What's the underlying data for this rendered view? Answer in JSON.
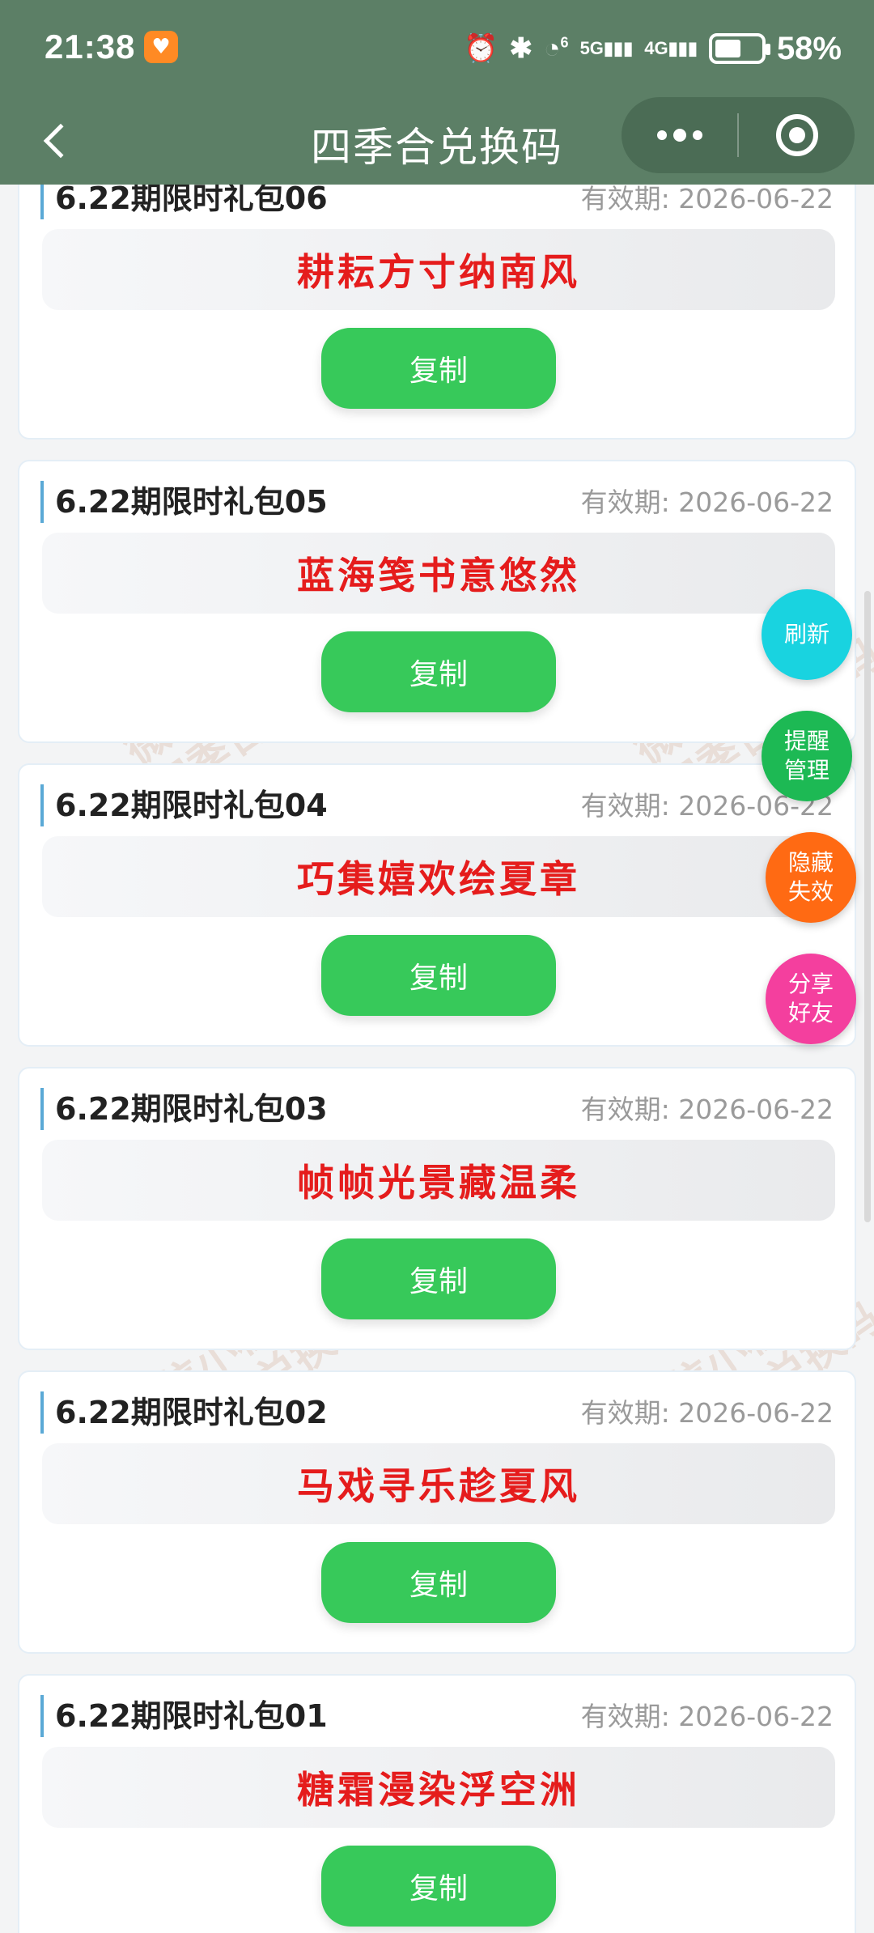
{
  "status_bar": {
    "time": "21:38",
    "app_badge_icon": "heart-icon",
    "icons": [
      "alarm-icon",
      "bluetooth-icon",
      "wifi-icon",
      "signal-5g-icon",
      "signal-4g-icon"
    ],
    "wifi_label": "6",
    "net_5g": "5G",
    "net_4g": "4G",
    "battery_level": 0.58,
    "battery_text": "58%"
  },
  "nav": {
    "title": "四季合兑换码"
  },
  "codes": [
    {
      "name": "6.22期限时礼包06",
      "expiry": "有效期: 2026-06-22",
      "code": "耕耘方寸纳南风",
      "copy_label": "复制"
    },
    {
      "name": "6.22期限时礼包05",
      "expiry": "有效期: 2026-06-22",
      "code": "蓝海笺书意悠然",
      "copy_label": "复制"
    },
    {
      "name": "6.22期限时礼包04",
      "expiry": "有效期: 2026-06-22",
      "code": "巧集嬉欢绘夏章",
      "copy_label": "复制"
    },
    {
      "name": "6.22期限时礼包03",
      "expiry": "有效期: 2026-06-22",
      "code": "帧帧光景藏温柔",
      "copy_label": "复制"
    },
    {
      "name": "6.22期限时礼包02",
      "expiry": "有效期: 2026-06-22",
      "code": "马戏寻乐趁夏风",
      "copy_label": "复制"
    },
    {
      "name": "6.22期限时礼包01",
      "expiry": "有效期: 2026-06-22",
      "code": "糖霜漫染浮空洲",
      "copy_label": "复制"
    }
  ],
  "watermark": {
    "line1": "微信小程序",
    "line2": "四季合兑换码"
  },
  "floating": {
    "refresh": "刷新",
    "reminder_line1": "提醒",
    "reminder_line2": "管理",
    "hide_line1": "隐藏",
    "hide_line2": "失效",
    "share_line1": "分享",
    "share_line2": "好友"
  },
  "colors": {
    "header_bg": "#5c7f66",
    "code_text": "#e51c1c",
    "copy_button": "#37c95a",
    "fab_refresh": "#19d3e0",
    "fab_reminder": "#1db954",
    "fab_hide": "#ff6a13",
    "fab_share": "#f43f9e"
  }
}
